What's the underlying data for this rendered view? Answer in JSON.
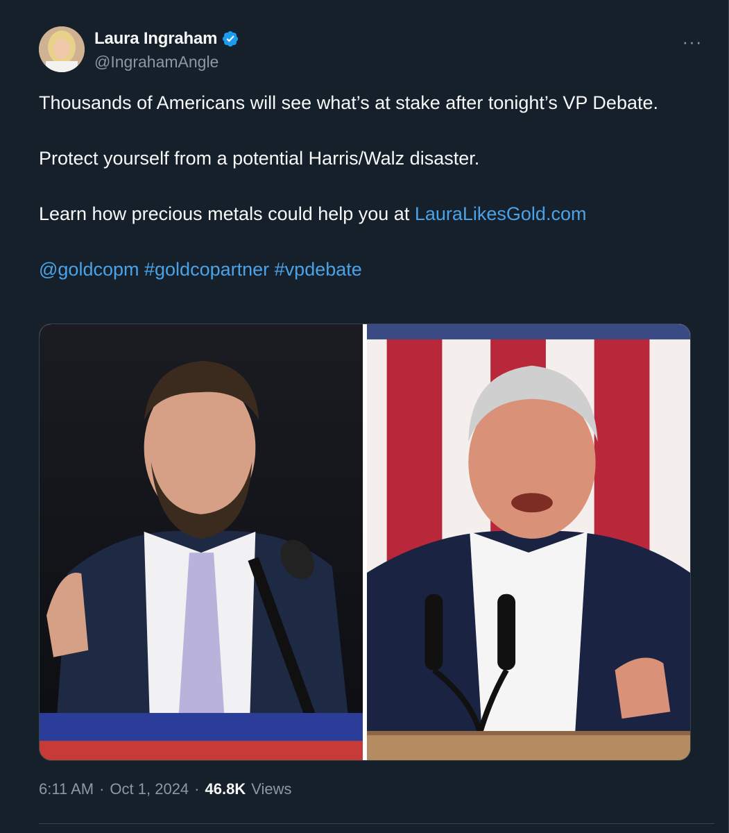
{
  "tweet": {
    "author": {
      "display_name": "Laura Ingraham",
      "handle": "@IngrahamAngle",
      "verified": true,
      "avatar_icon": "avatar-photo"
    },
    "more_label": "···",
    "text": {
      "line1": "Thousands of Americans will see what’s at stake after tonight’s VP Debate.",
      "line2": "Protect yourself from a potential Harris/Walz disaster.",
      "line3_prefix": "Learn how precious metals could help you at ",
      "line3_link": "LauraLikesGold.com",
      "mention": "@goldcopm",
      "hashtag1": "#goldcopartner",
      "hashtag2": "#vpdebate"
    },
    "media": {
      "left_alt": "photo-man-speaking-at-podium",
      "right_alt": "photo-man-speaking-at-microphones"
    },
    "meta": {
      "time": "6:11 AM",
      "separator": "·",
      "date": "Oct 1, 2024",
      "views_count": "46.8K",
      "views_label": "Views"
    }
  },
  "colors": {
    "background": "#15202b",
    "text": "#f7f9f9",
    "muted": "#8b98a5",
    "link": "#4aa3e8",
    "verified": "#1d9bf0"
  }
}
